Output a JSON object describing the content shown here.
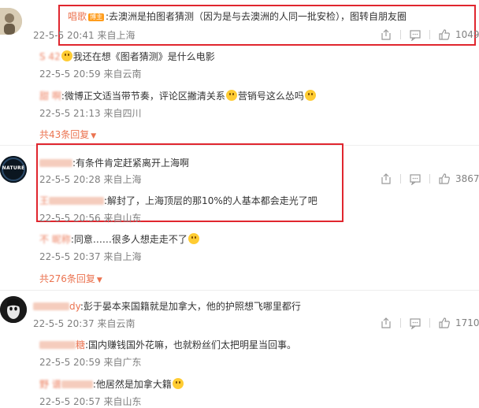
{
  "threads": [
    {
      "author": "唱歌",
      "badge": "博主",
      "text": ":去澳洲是拍图者猜测（因为是与去澳洲的人同一批安检），图转自朋友圈",
      "time": "22-5-5 20:41",
      "location": "来自上海",
      "likes": "1049",
      "replies": [
        {
          "author": "S 42",
          "text": "我还在想《图者猜测》是什么电影",
          "time": "22-5-5 20:59",
          "location": "来自云南"
        },
        {
          "author": "甜 啊",
          "text": ":微博正文适当带节奏，评论区撇清关系",
          "text2": "营销号这么怂吗",
          "time": "22-5-5 21:13",
          "location": "来自四川"
        }
      ],
      "more_label": "共43条回复"
    },
    {
      "author": "",
      "avatar_text": "NATURE",
      "text": ":有条件肯定赶紧离开上海啊",
      "time": "22-5-5 20:28",
      "location": "来自上海",
      "likes": "3867",
      "replies": [
        {
          "author": "王",
          "text": ":解封了，上海顶层的那10%的人基本都会走光了吧",
          "time": "22-5-5 20:56",
          "location": "来自山东"
        },
        {
          "author": "不 昵称",
          "text": ":同意……很多人想走走不了",
          "time": "22-5-5 20:37",
          "location": "来自上海"
        }
      ],
      "more_label": "共276条回复"
    },
    {
      "author": "dy",
      "text": ":彭于晏本来国籍就是加拿大，他的护照想飞哪里都行",
      "time": "22-5-5 20:37",
      "location": "来自云南",
      "likes": "1710",
      "replies": [
        {
          "author": "糖",
          "text": ":国内赚钱国外花嘛，也就粉丝们太把明星当回事。",
          "time": "22-5-5 20:59",
          "location": "来自广东"
        },
        {
          "author": "野 谱",
          "text": ":他居然是加拿大籍",
          "time": "22-5-5 20:57",
          "location": "来自山东"
        }
      ]
    }
  ],
  "colors": {
    "username": "#eb7350",
    "highlight_box": "#e0262e",
    "meta": "#808080"
  },
  "icons": [
    "share-icon",
    "comment-icon",
    "like-icon",
    "chevron-down-icon"
  ]
}
